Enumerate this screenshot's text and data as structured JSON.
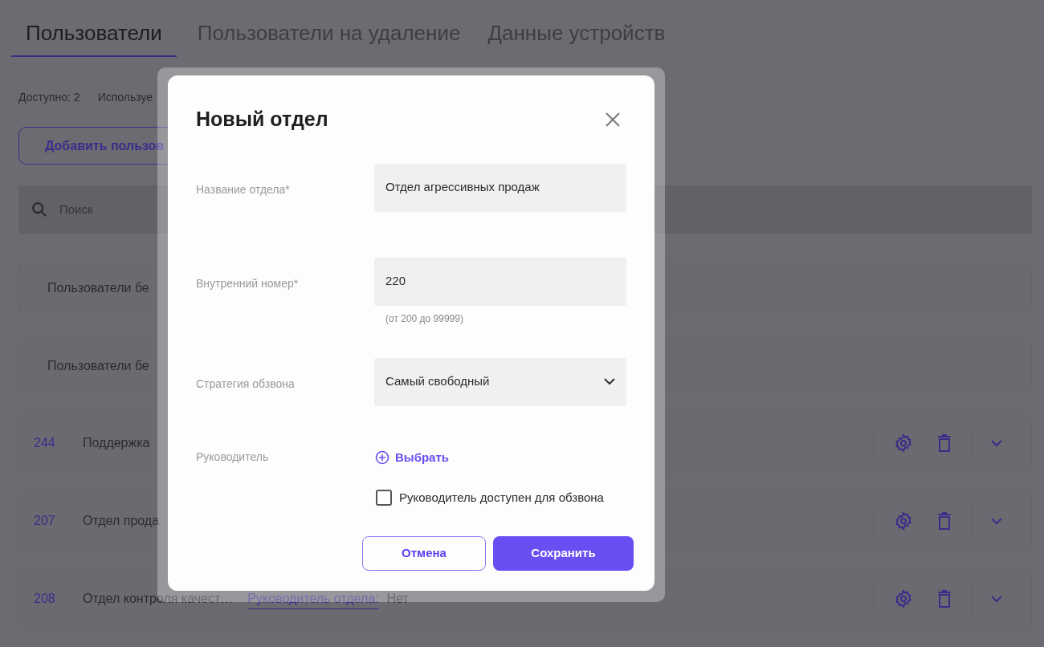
{
  "tabs": [
    {
      "label": "Пользователи",
      "selected": true
    },
    {
      "label": "Пользователи на удаление",
      "selected": false
    },
    {
      "label": "Данные устройств",
      "selected": false
    }
  ],
  "stats": [
    "Доступно: 2",
    "Используе"
  ],
  "add_button": "Добавить пользов",
  "search": {
    "placeholder": "Поиск"
  },
  "groups": [
    {
      "label": "Пользователи бе"
    },
    {
      "label": "Пользователи бе"
    }
  ],
  "departments": [
    {
      "number": "244",
      "name": "Поддержка"
    },
    {
      "number": "207",
      "name": "Отдел прода"
    },
    {
      "number": "208",
      "name": "Отдел контроля качест…",
      "manager_link": "Руководитель отдела:",
      "manager_value": "Нет"
    }
  ],
  "dialog": {
    "title": "Новый отдел",
    "fields": [
      {
        "kind": "text",
        "label": "Название отдела*",
        "value": "Отдел агрессивных продаж"
      },
      {
        "kind": "text",
        "label": "Внутренний номер*",
        "value": "220",
        "hint": "(от 200 до 99999)"
      },
      {
        "kind": "select",
        "label": "Стратегия обзвона",
        "value": "Самый свободный"
      },
      {
        "kind": "picker",
        "label": "Руководитель",
        "value": "Выбрать"
      }
    ],
    "checkbox": {
      "label": "Руководитель доступен для обзвона",
      "checked": false
    },
    "cancel": "Отмена",
    "save": "Сохранить"
  }
}
